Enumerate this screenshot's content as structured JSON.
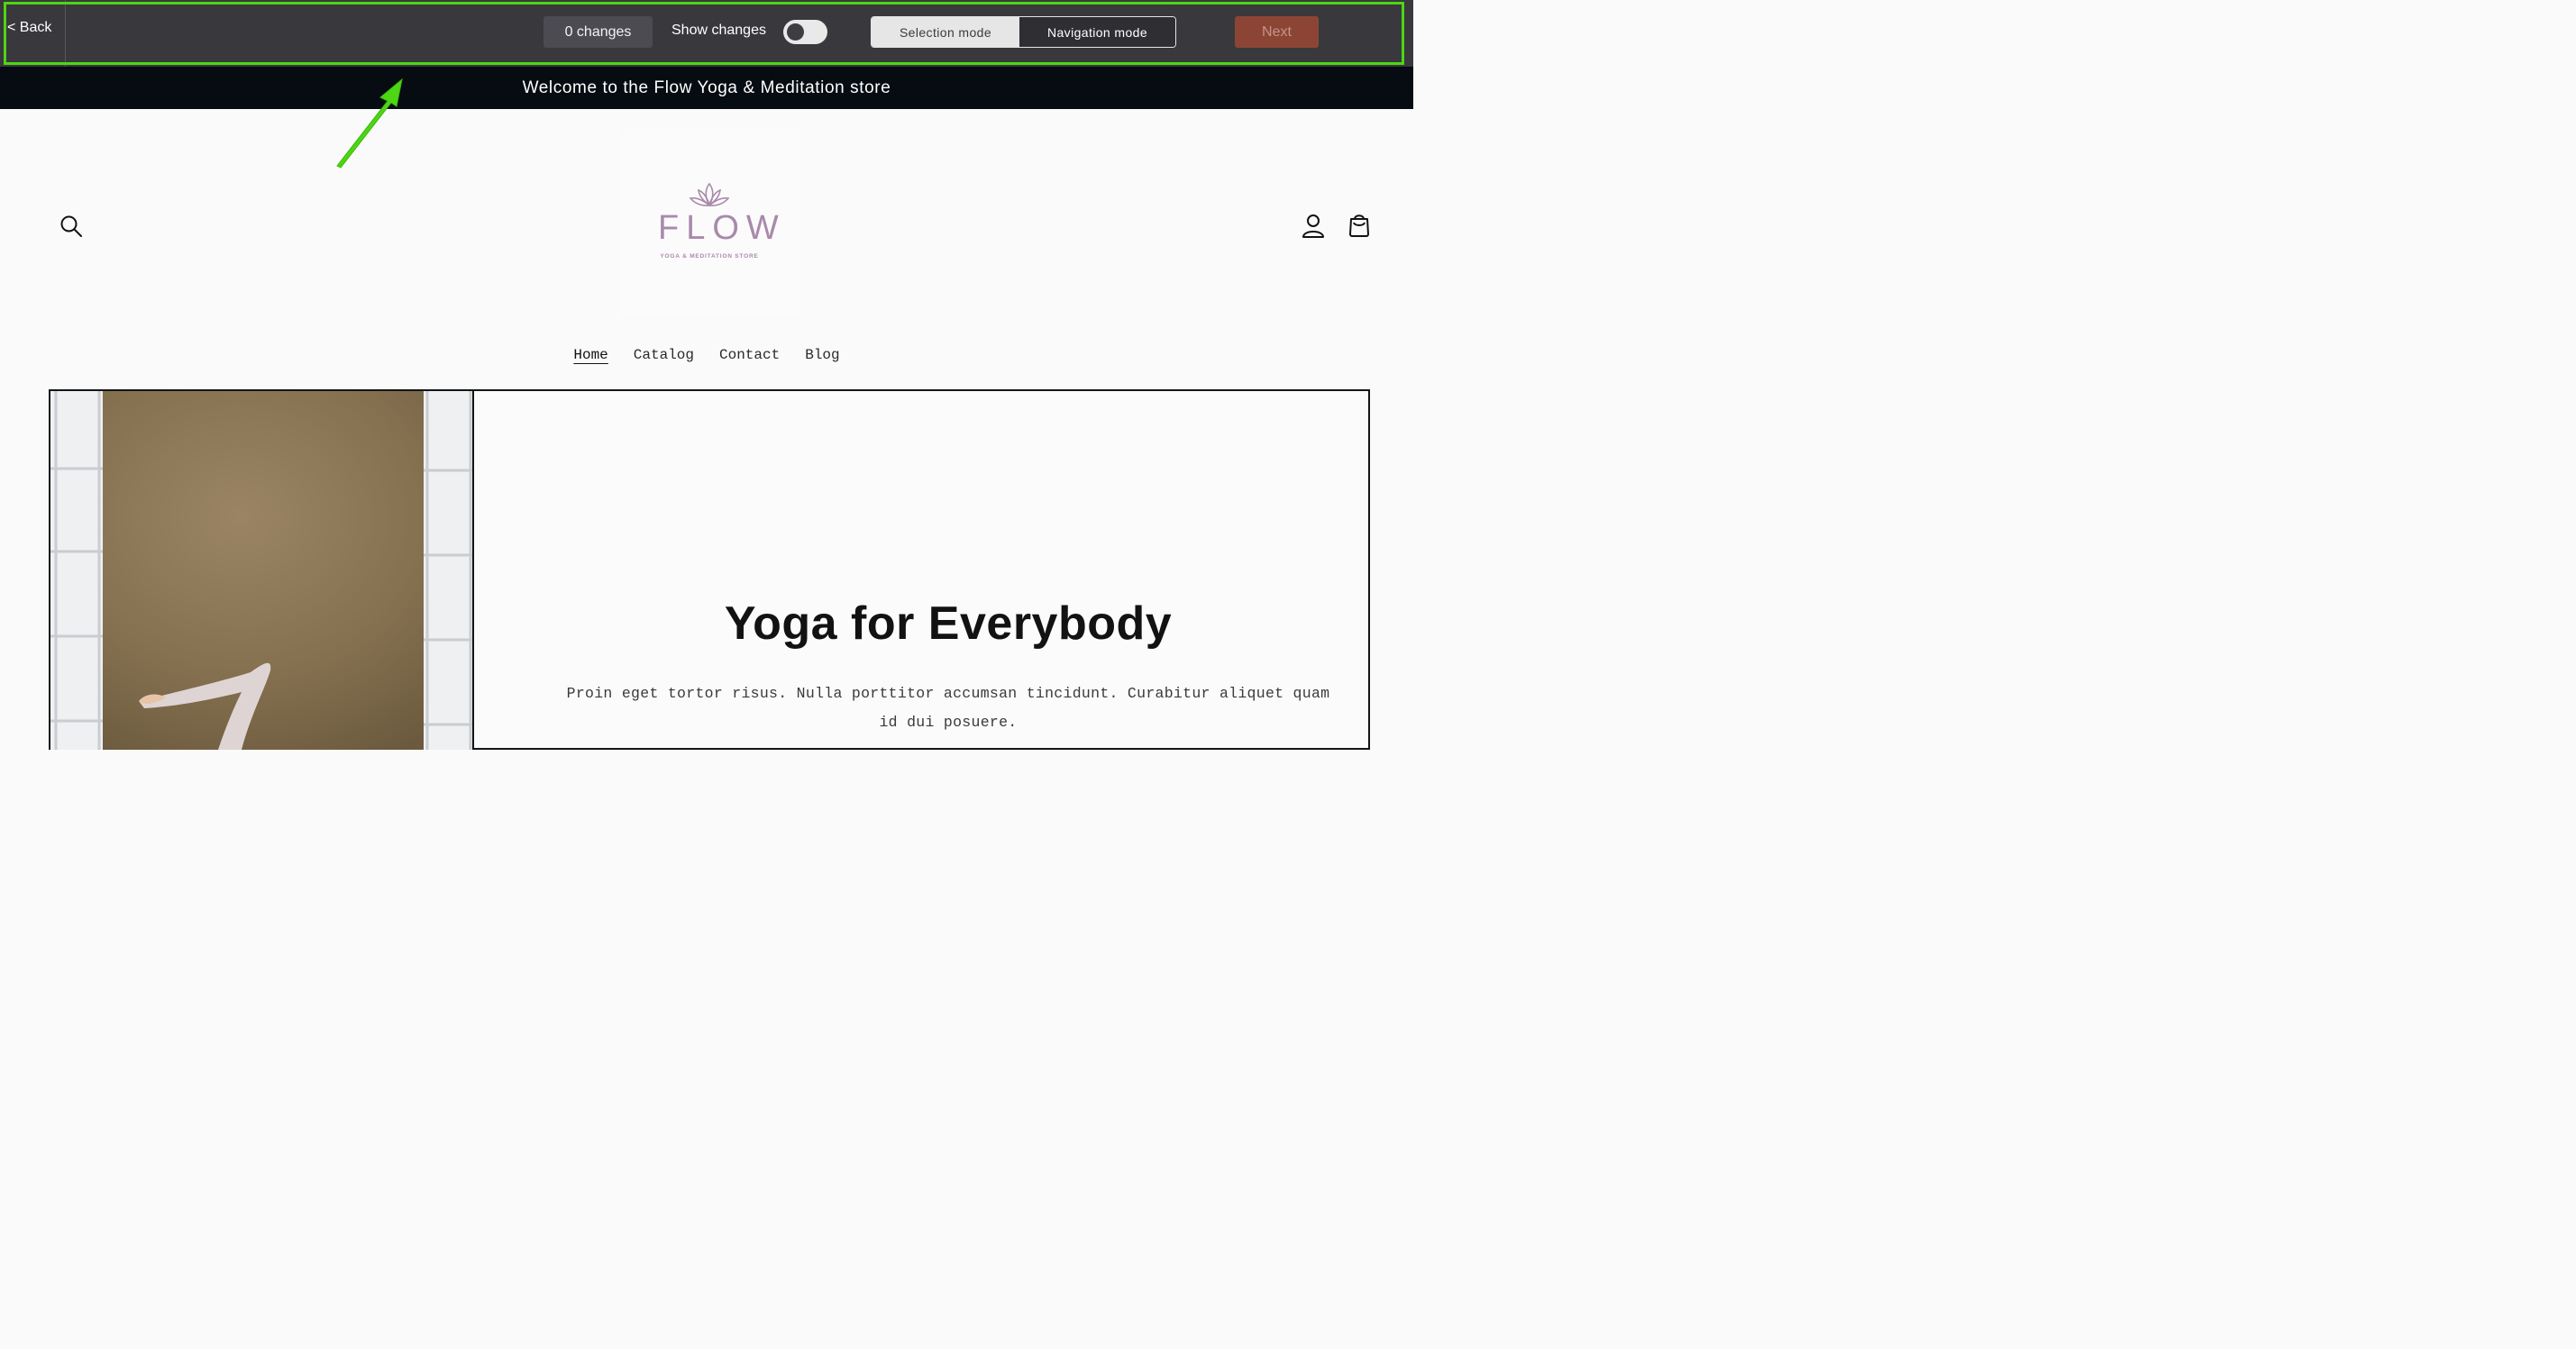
{
  "toolbar": {
    "back_label": "< Back",
    "changes_label": "0 changes",
    "show_changes_label": "Show changes",
    "show_changes_on": false,
    "selection_mode_label": "Selection mode",
    "navigation_mode_label": "Navigation mode",
    "active_mode": "Navigation mode",
    "next_label": "Next",
    "highlight_color": "#4cd613"
  },
  "announcement": {
    "text": "Welcome to the Flow Yoga & Meditation store"
  },
  "header": {
    "logo_word": "FLOW",
    "logo_tagline": "YOGA & MEDITATION STORE",
    "brand_color": "#a98aab",
    "icons": [
      "search-icon",
      "account-icon",
      "cart-icon"
    ]
  },
  "nav": {
    "items": [
      {
        "label": "Home",
        "active": true
      },
      {
        "label": "Catalog",
        "active": false
      },
      {
        "label": "Contact",
        "active": false
      },
      {
        "label": "Blog",
        "active": false
      }
    ]
  },
  "hero": {
    "title": "Yoga for Everybody",
    "text": "Proin eget tortor risus. Nulla porttitor accumsan tincidunt. Curabitur aliquet quam id dui posuere."
  }
}
